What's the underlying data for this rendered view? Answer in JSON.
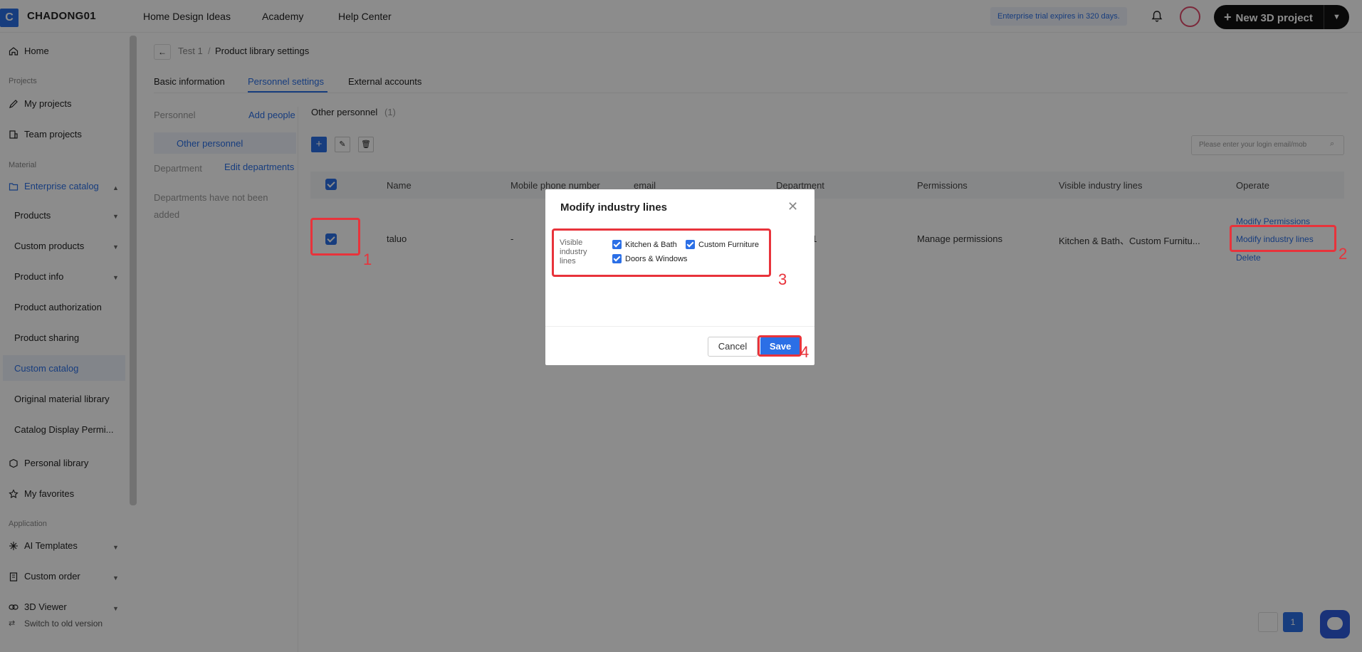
{
  "topbar": {
    "logo_letter": "C",
    "brand": "CHADONG01",
    "nav": [
      "Home Design Ideas",
      "Academy",
      "Help Center"
    ],
    "trial_notice": "Enterprise trial expires in 320 days.",
    "new_project_label": "New 3D project"
  },
  "sidebar": {
    "home": "Home",
    "cap_projects": "Projects",
    "my_projects": "My projects",
    "team_projects": "Team projects",
    "cap_material": "Material",
    "enterprise_catalog": "Enterprise catalog",
    "products": "Products",
    "custom_products": "Custom products",
    "product_info": "Product info",
    "product_authorization": "Product authorization",
    "product_sharing": "Product sharing",
    "custom_catalog": "Custom catalog",
    "original_material_library": "Original material library",
    "catalog_display": "Catalog Display Permi...",
    "personal_library": "Personal library",
    "my_favorites": "My favorites",
    "cap_application": "Application",
    "ai_templates": "AI Templates",
    "custom_order": "Custom order",
    "viewer_3d": "3D Viewer",
    "switch_old": "Switch to old version"
  },
  "breadcrumb": {
    "parent": "Test 1",
    "current": "Product library settings"
  },
  "tabs": [
    "Basic information",
    "Personnel settings",
    "External accounts"
  ],
  "left_panel": {
    "personnel_cap": "Personnel",
    "add_people": "Add people",
    "other_personnel": "Other personnel",
    "department_cap": "Department",
    "edit_departments": "Edit departments",
    "dept_empty": "Departments have not been added"
  },
  "content": {
    "section_title": "Other personnel",
    "section_count": "(1)",
    "search_placeholder": "Please enter your login email/mob",
    "columns": [
      "Name",
      "Mobile phone number",
      "email",
      "Department",
      "Permissions",
      "Visible industry lines",
      "Operate"
    ],
    "row": {
      "name": "taluo",
      "mobile": "-",
      "department": "01",
      "permissions": "Manage permissions",
      "visible_lines": "Kitchen & Bath、Custom Furnitu..."
    },
    "operate_links": [
      "Modify Permissions",
      "Modify industry lines",
      "Delete"
    ],
    "page": "1"
  },
  "modal": {
    "title": "Modify industry lines",
    "field_label": "Visible industry lines",
    "options": [
      "Kitchen & Bath",
      "Custom Furniture",
      "Doors & Windows"
    ],
    "cancel": "Cancel",
    "save": "Save"
  },
  "annotations": [
    "1",
    "2",
    "3",
    "4"
  ],
  "colors": {
    "accent": "#2b6fe6",
    "annotation": "#e8333b",
    "overlay": "rgba(0,0,0,0.45)"
  }
}
